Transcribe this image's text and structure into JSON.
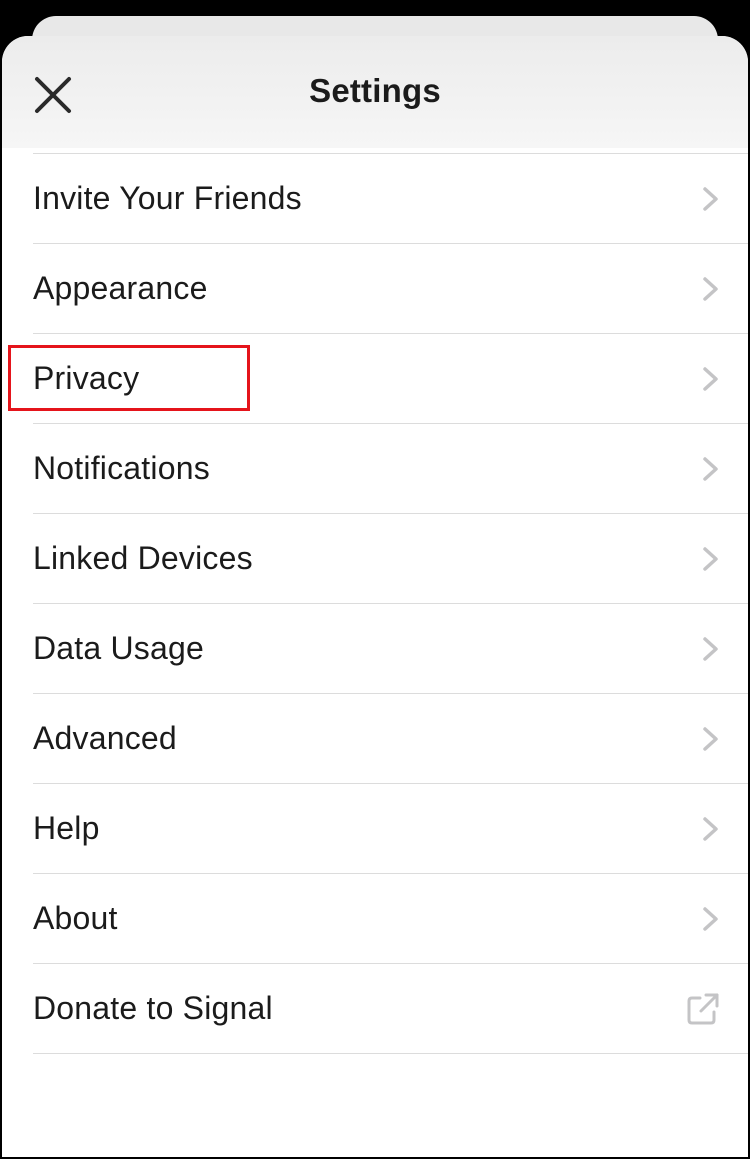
{
  "header": {
    "title": "Settings",
    "close_icon": "close-icon"
  },
  "settings": {
    "items": [
      {
        "label": "Invite Your Friends",
        "icon": "chevron-right-icon"
      },
      {
        "label": "Appearance",
        "icon": "chevron-right-icon"
      },
      {
        "label": "Privacy",
        "icon": "chevron-right-icon",
        "highlighted": true
      },
      {
        "label": "Notifications",
        "icon": "chevron-right-icon"
      },
      {
        "label": "Linked Devices",
        "icon": "chevron-right-icon"
      },
      {
        "label": "Data Usage",
        "icon": "chevron-right-icon"
      },
      {
        "label": "Advanced",
        "icon": "chevron-right-icon"
      },
      {
        "label": "Help",
        "icon": "chevron-right-icon"
      },
      {
        "label": "About",
        "icon": "chevron-right-icon"
      },
      {
        "label": "Donate to Signal",
        "icon": "external-link-icon"
      }
    ]
  },
  "colors": {
    "highlight": "#e5141b",
    "text": "#1b1b1b",
    "chevron": "#c4c4c6",
    "separator": "#dcdcdc"
  }
}
